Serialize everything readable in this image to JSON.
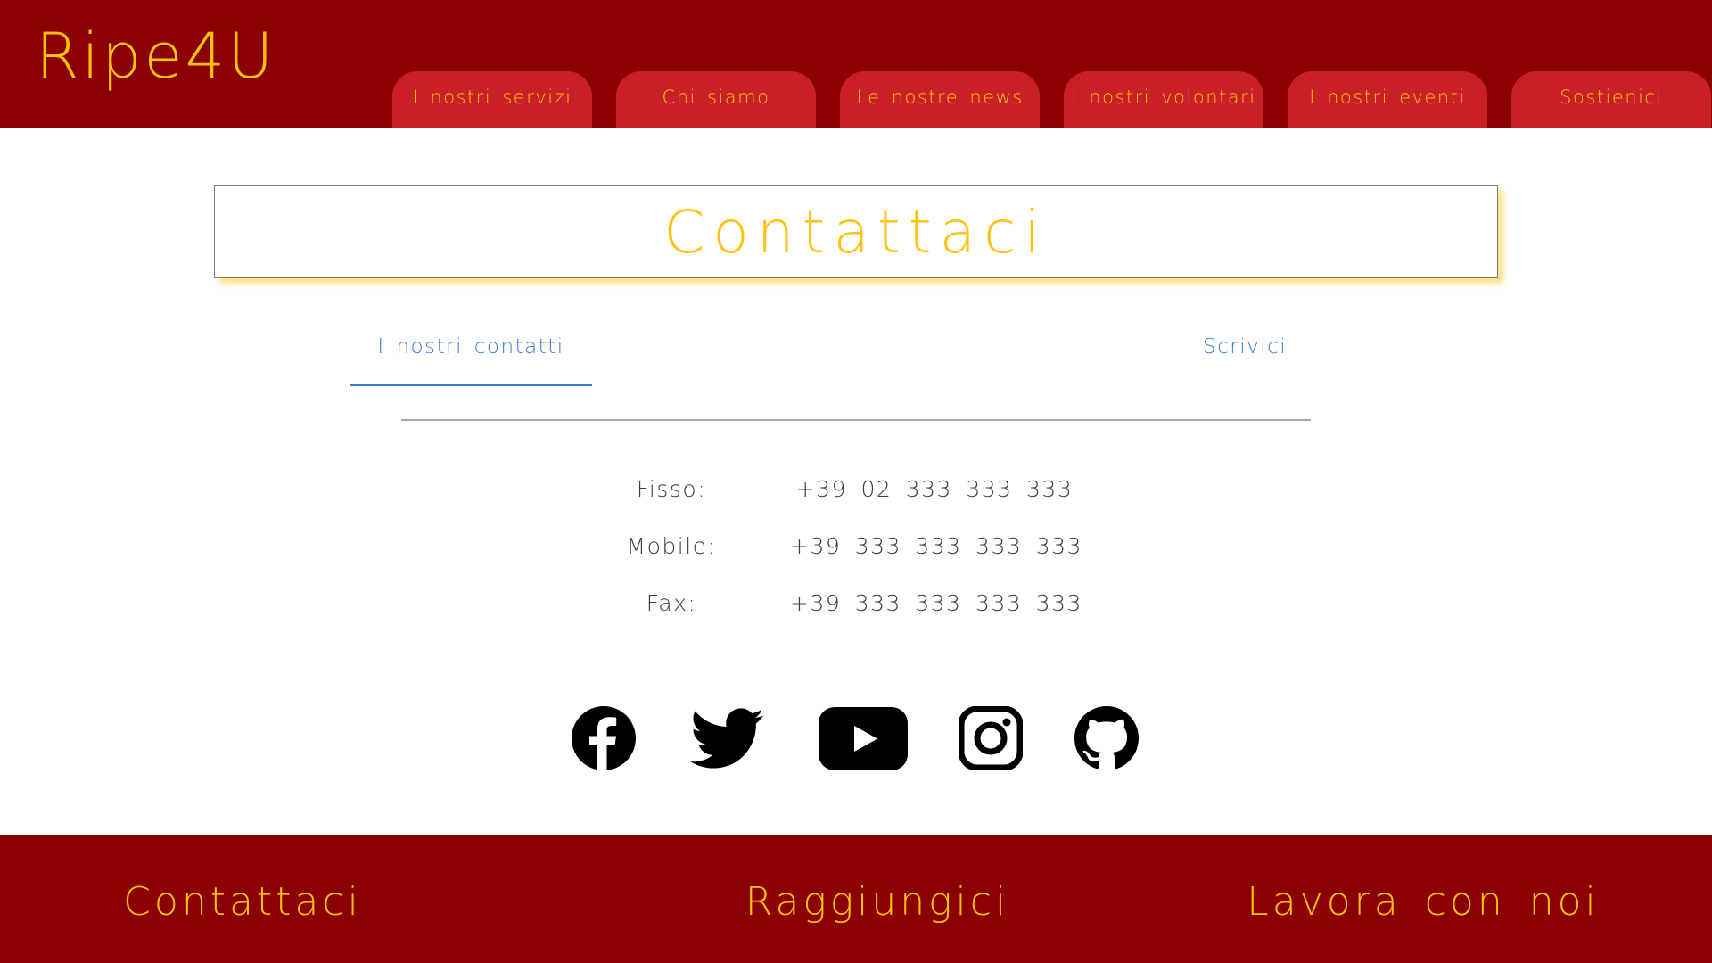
{
  "header": {
    "logo": "Ripe4U",
    "nav": [
      {
        "label": "I nostri servizi"
      },
      {
        "label": "Chi siamo"
      },
      {
        "label": "Le nostre news"
      },
      {
        "label": "I nostri volontari"
      },
      {
        "label": "I nostri eventi"
      },
      {
        "label": "Sostienici"
      }
    ]
  },
  "main": {
    "title": "Contattaci",
    "tabs": [
      {
        "label": "I nostri contatti",
        "active": true
      },
      {
        "label": "Scrivici",
        "active": false
      }
    ],
    "contacts": [
      {
        "label": "Fisso:",
        "value": "+39 02 333 333 333"
      },
      {
        "label": "Mobile:",
        "value": "+39 333 333 333 333"
      },
      {
        "label": "Fax:",
        "value": "+39 333 333 333 333"
      }
    ],
    "social": [
      {
        "icon": "facebook-icon"
      },
      {
        "icon": "twitter-icon"
      },
      {
        "icon": "youtube-icon"
      },
      {
        "icon": "instagram-icon"
      },
      {
        "icon": "github-icon"
      }
    ]
  },
  "footer": {
    "links": [
      {
        "label": "Contattaci"
      },
      {
        "label": "Raggiungici"
      },
      {
        "label": "Lavora con noi"
      }
    ]
  },
  "colors": {
    "header_bg": "#8b0000",
    "nav_tab_bg": "#c92027",
    "accent_yellow": "#ffc20e",
    "tab_blue": "#3a7bd5",
    "text_gray": "#3d3d3d"
  }
}
